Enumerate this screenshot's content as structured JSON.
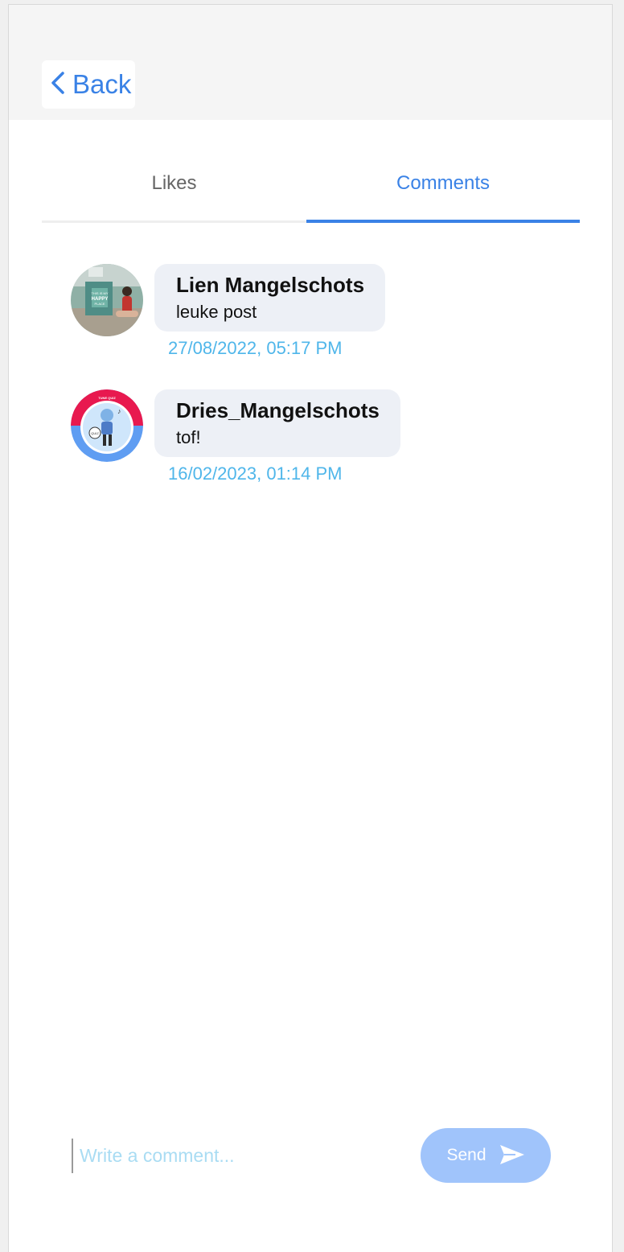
{
  "header": {
    "back_label": "Back",
    "back_icon": "chevron-left-icon",
    "accent_color": "#3a82e6"
  },
  "tabs": [
    {
      "label": "Likes",
      "active": false
    },
    {
      "label": "Comments",
      "active": true
    }
  ],
  "comments": [
    {
      "author": "Lien Mangelschots",
      "text": "leuke post",
      "date": "27/08/2022, 05:17 PM",
      "avatar_photo_caption": "THIS IS MY HAPPY PLACE"
    },
    {
      "author": "Dries_Mangelschots",
      "text": "tof!",
      "date": "16/02/2023, 01:14 PM",
      "avatar_logo_text": "TUNE QUIZ"
    }
  ],
  "composer": {
    "placeholder": "Write a comment...",
    "send_label": "Send",
    "send_icon": "send-icon"
  }
}
